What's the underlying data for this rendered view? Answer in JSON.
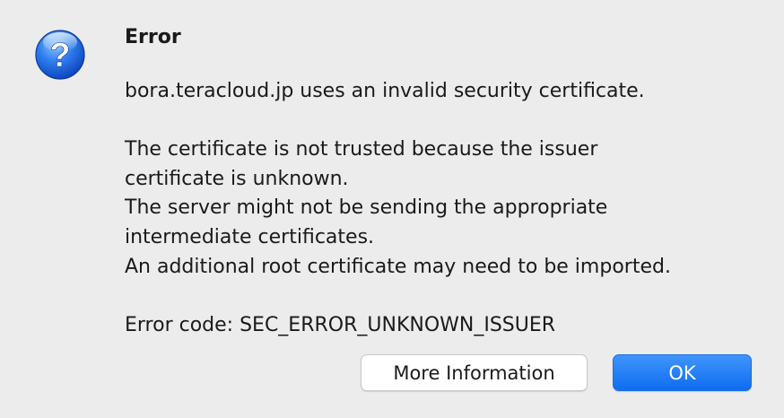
{
  "dialog": {
    "title": "Error",
    "icon": "question-mark-icon",
    "lines": {
      "l1": "bora.teracloud.jp uses an invalid security certificate.",
      "l2": "The certificate is not trusted because the issuer",
      "l3": "certificate is unknown.",
      "l4": "The server might not be sending the appropriate",
      "l5": "intermediate certificates.",
      "l6": "An additional root certificate may need to be imported.",
      "l7": "Error code: SEC_ERROR_UNKNOWN_ISSUER"
    },
    "buttons": {
      "more_info": "More Information",
      "ok": "OK"
    },
    "colors": {
      "accent": "#1a78f5",
      "background": "#ececec"
    }
  }
}
